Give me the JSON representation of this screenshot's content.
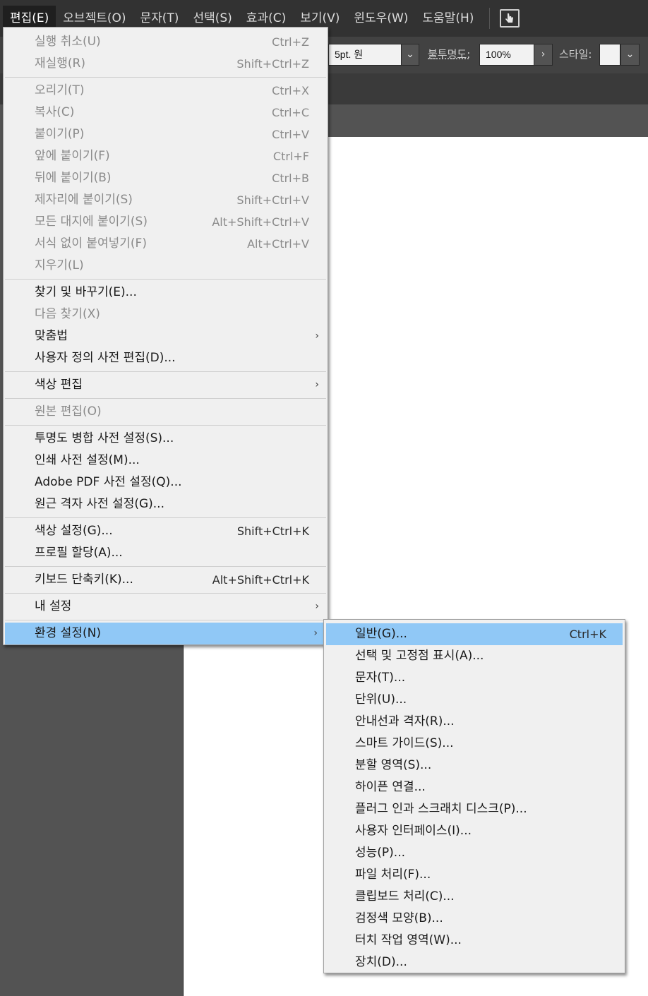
{
  "menubar": {
    "items": [
      "편집(E)",
      "오브젝트(O)",
      "문자(T)",
      "선택(S)",
      "효과(C)",
      "보기(V)",
      "윈도우(W)",
      "도움말(H)"
    ],
    "active_index": 0,
    "tool_icon": "hand-cursor-icon"
  },
  "controlbar": {
    "stroke_profile": "5pt. 원",
    "opacity_label": "불투명도:",
    "opacity_value": "100%",
    "style_label": "스타일:"
  },
  "edit_menu": {
    "items": [
      {
        "label": "실행 취소(U)",
        "shortcut": "Ctrl+Z",
        "disabled": true
      },
      {
        "label": "재실행(R)",
        "shortcut": "Shift+Ctrl+Z",
        "disabled": true
      },
      {
        "label": "오리기(T)",
        "shortcut": "Ctrl+X",
        "disabled": true
      },
      {
        "label": "복사(C)",
        "shortcut": "Ctrl+C",
        "disabled": true
      },
      {
        "label": "붙이기(P)",
        "shortcut": "Ctrl+V",
        "disabled": true
      },
      {
        "label": "앞에 붙이기(F)",
        "shortcut": "Ctrl+F",
        "disabled": true
      },
      {
        "label": "뒤에 붙이기(B)",
        "shortcut": "Ctrl+B",
        "disabled": true
      },
      {
        "label": "제자리에 붙이기(S)",
        "shortcut": "Shift+Ctrl+V",
        "disabled": true
      },
      {
        "label": "모든 대지에 붙이기(S)",
        "shortcut": "Alt+Shift+Ctrl+V",
        "disabled": true
      },
      {
        "label": "서식 없이 붙여넣기(F)",
        "shortcut": "Alt+Ctrl+V",
        "disabled": true
      },
      {
        "label": "지우기(L)",
        "shortcut": "",
        "disabled": true
      },
      {
        "label": "찾기 및 바꾸기(E)...",
        "shortcut": "",
        "disabled": false
      },
      {
        "label": "다음 찾기(X)",
        "shortcut": "",
        "disabled": true
      },
      {
        "label": "맞춤법",
        "shortcut": "",
        "disabled": false,
        "submenu": true
      },
      {
        "label": "사용자 정의 사전 편집(D)...",
        "shortcut": "",
        "disabled": false
      },
      {
        "label": "색상 편집",
        "shortcut": "",
        "disabled": false,
        "submenu": true
      },
      {
        "label": "원본 편집(O)",
        "shortcut": "",
        "disabled": true
      },
      {
        "label": "투명도 병합 사전 설정(S)...",
        "shortcut": "",
        "disabled": false
      },
      {
        "label": "인쇄 사전 설정(M)...",
        "shortcut": "",
        "disabled": false
      },
      {
        "label": "Adobe PDF 사전 설정(Q)...",
        "shortcut": "",
        "disabled": false
      },
      {
        "label": "원근 격자 사전 설정(G)...",
        "shortcut": "",
        "disabled": false
      },
      {
        "label": "색상 설정(G)...",
        "shortcut": "Shift+Ctrl+K",
        "disabled": false
      },
      {
        "label": "프로필 할당(A)...",
        "shortcut": "",
        "disabled": false
      },
      {
        "label": "키보드 단축키(K)...",
        "shortcut": "Alt+Shift+Ctrl+K",
        "disabled": false
      },
      {
        "label": "내 설정",
        "shortcut": "",
        "disabled": false,
        "submenu": true
      },
      {
        "label": "환경 설정(N)",
        "shortcut": "",
        "disabled": false,
        "submenu": true,
        "highlighted": true
      }
    ],
    "arrow": "›"
  },
  "preferences_submenu": {
    "items": [
      {
        "label": "일반(G)...",
        "shortcut": "Ctrl+K",
        "highlighted": true
      },
      {
        "label": "선택 및 고정점 표시(A)...",
        "shortcut": ""
      },
      {
        "label": "문자(T)...",
        "shortcut": ""
      },
      {
        "label": "단위(U)...",
        "shortcut": ""
      },
      {
        "label": "안내선과 격자(R)...",
        "shortcut": ""
      },
      {
        "label": "스마트 가이드(S)...",
        "shortcut": ""
      },
      {
        "label": "분할 영역(S)...",
        "shortcut": ""
      },
      {
        "label": "하이픈 연결...",
        "shortcut": ""
      },
      {
        "label": "플러그 인과 스크래치 디스크(P)...",
        "shortcut": ""
      },
      {
        "label": "사용자 인터페이스(I)...",
        "shortcut": ""
      },
      {
        "label": "성능(P)...",
        "shortcut": ""
      },
      {
        "label": "파일 처리(F)...",
        "shortcut": ""
      },
      {
        "label": "클립보드 처리(C)...",
        "shortcut": ""
      },
      {
        "label": "검정색 모양(B)...",
        "shortcut": ""
      },
      {
        "label": "터치 작업 영역(W)...",
        "shortcut": ""
      },
      {
        "label": "장치(D)...",
        "shortcut": ""
      }
    ]
  },
  "colors": {
    "menubar_bg": "#323232",
    "controlbar_bg": "#424242",
    "workspace_bg": "#535353",
    "menu_bg": "#f0f0f0",
    "highlight": "#90c8f6",
    "disabled_text": "#8a8a8a"
  }
}
